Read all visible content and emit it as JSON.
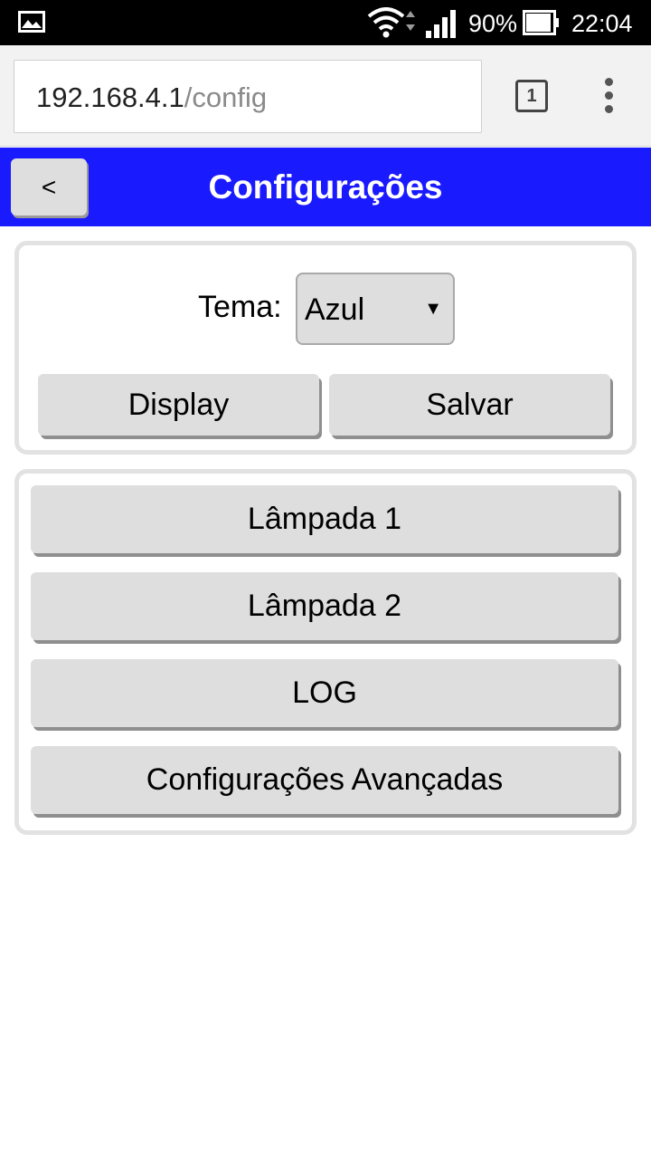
{
  "status_bar": {
    "battery_percent": "90%",
    "time": "22:04",
    "icons": [
      "gallery-icon",
      "wifi-icon",
      "signal-icon",
      "battery-icon"
    ]
  },
  "browser": {
    "url_host": "192.168.4.1",
    "url_path": "/config",
    "tab_count": "1",
    "icons": [
      "tabs-icon",
      "overflow-menu-icon"
    ]
  },
  "header": {
    "back_label": "<",
    "title": "Configurações",
    "background_color": "#1a1aff"
  },
  "theme_panel": {
    "label": "Tema:",
    "selected_theme": "Azul",
    "select_arrow": "▼",
    "display_button": "Display",
    "save_button": "Salvar"
  },
  "menu": {
    "items": [
      {
        "label": "Lâmpada 1"
      },
      {
        "label": "Lâmpada 2"
      },
      {
        "label": "LOG"
      },
      {
        "label": "Configurações Avançadas"
      }
    ]
  }
}
